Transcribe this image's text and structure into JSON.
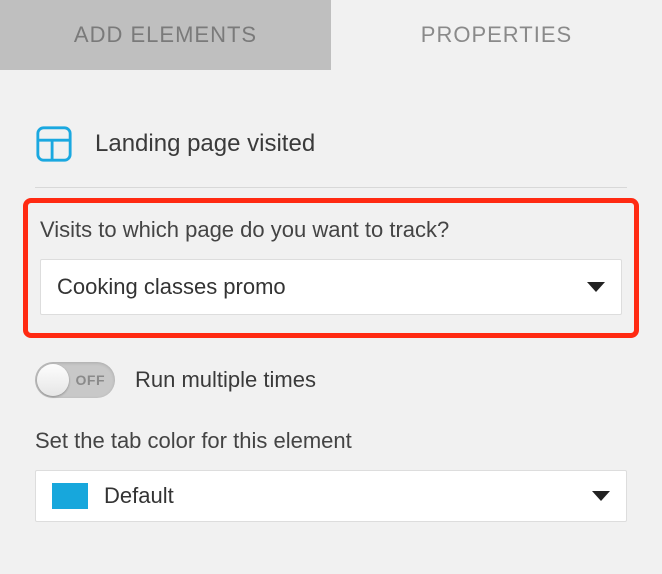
{
  "tabs": {
    "add_elements": "ADD ELEMENTS",
    "properties": "PROPERTIES"
  },
  "element": {
    "title": "Landing page visited"
  },
  "track": {
    "label": "Visits to which page do you want to track?",
    "selected": "Cooking classes promo"
  },
  "toggle": {
    "state_text": "OFF",
    "label": "Run multiple times"
  },
  "tab_color": {
    "label": "Set the tab color for this element",
    "selected": "Default",
    "swatch": "#17a7dc"
  }
}
